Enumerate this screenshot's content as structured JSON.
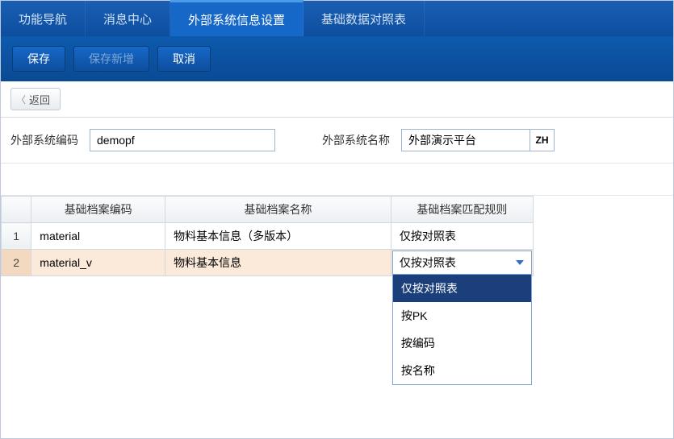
{
  "tabs": {
    "items": [
      {
        "label": "功能导航"
      },
      {
        "label": "消息中心"
      },
      {
        "label": "外部系统信息设置"
      },
      {
        "label": "基础数据对照表"
      }
    ]
  },
  "toolbar": {
    "save": "保存",
    "saveNew": "保存新增",
    "cancel": "取消"
  },
  "backBar": {
    "back": "返回"
  },
  "form": {
    "codeLabel": "外部系统编码",
    "codeValue": "demopf",
    "nameLabel": "外部系统名称",
    "nameValue": "外部演示平台",
    "langBtn": "ZH"
  },
  "grid": {
    "headers": {
      "code": "基础档案编码",
      "name": "基础档案名称",
      "rule": "基础档案匹配规则"
    },
    "rows": [
      {
        "num": "1",
        "code": "material",
        "name": "物料基本信息（多版本）",
        "rule": "仅按对照表"
      },
      {
        "num": "2",
        "code": "material_v",
        "name": "物料基本信息",
        "rule": "仅按对照表"
      }
    ]
  },
  "dropdown": {
    "options": [
      "仅按对照表",
      "按PK",
      "按编码",
      "按名称"
    ]
  }
}
